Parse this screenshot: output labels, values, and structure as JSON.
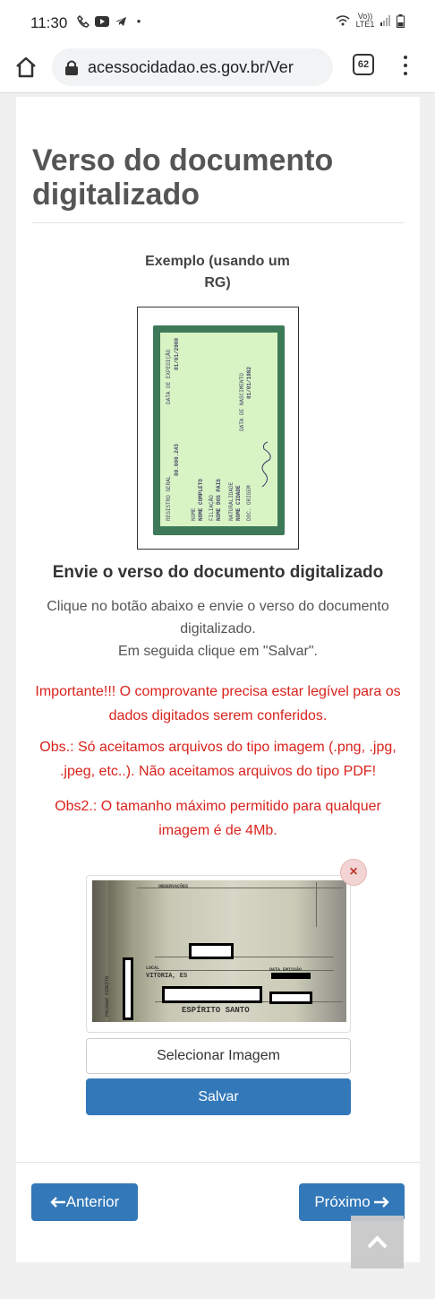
{
  "status_bar": {
    "time": "11:30",
    "battery_label": "Vo)) LTE1"
  },
  "browser": {
    "url": "acessocidadao.es.gov.br/Ver",
    "tab_count": "62"
  },
  "page": {
    "title": "Verso do documento digitalizado",
    "example_caption": "Exemplo (usando um RG)",
    "example_card": {
      "registro": "REGISTRO GERAL",
      "registro_value": "00.000.243",
      "data_expedicao": "DATA DE EXPEDIÇÃO",
      "data_expedicao_value": "01/01/2000",
      "nome_label": "NOME",
      "nome_value": "NOME COMPLETO",
      "filiacao_label": "FILIAÇÃO",
      "filiacao_value": "NOME DOS PAIS",
      "naturalidade_label": "NATURALIDADE",
      "naturalidade_value": "NOME CIDADE",
      "doc_origem": "DOC. ORIGEM",
      "data_nascimento": "DATA DE NASCIMENTO",
      "data_nascimento_value": "01/01/1982"
    },
    "section_heading": "Envie o verso do documento digitalizado",
    "instructions_1": "Clique no botão abaixo e envie o verso do documento digitalizado.",
    "instructions_2": "Em seguida clique em \"Salvar\".",
    "warning_1": "Importante!!! O comprovante precisa estar legível para os dados digitados serem conferidos.",
    "warning_2": "Obs.: Só aceitamos arquivos do tipo imagem (.png, .jpg, .jpeg, etc..). Não aceitamos arquivos do tipo PDF!",
    "warning_3": "Obs2.: O tamanho máximo permitido para qualquer imagem é de 4Mb.",
    "uploaded_photo": {
      "label_local": "LOCAL",
      "text_city": "VITORIA, ES",
      "text_state": "ESPÍRITO SANTO",
      "label_data": "DATA EMISSÃO",
      "label_observacoes": "OBSERVAÇÕES",
      "label_polegar": "POLEGAR DIREITO"
    },
    "remove_label": "×",
    "select_button": "Selecionar Imagem",
    "save_button": "Salvar",
    "prev_button": "Anterior",
    "next_button": "Próximo"
  },
  "colors": {
    "primary": "#3378b8",
    "warning": "#d9231d",
    "card_green": "#3e7a59",
    "card_light": "#d8f4c5"
  },
  "icons": [
    "home-icon",
    "lock-icon",
    "tabs-icon",
    "kebab-menu-icon",
    "close-icon",
    "arrow-left-icon",
    "arrow-right-icon",
    "chevron-up-icon"
  ]
}
